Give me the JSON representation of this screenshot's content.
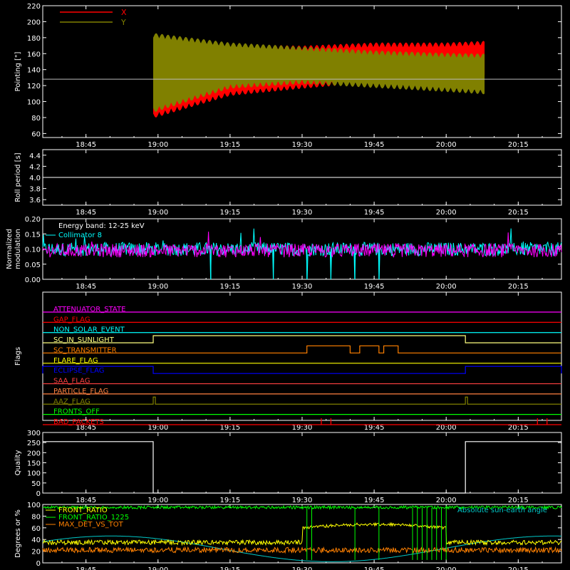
{
  "time_axis": {
    "start": "18:36",
    "end": "20:24",
    "ticks": [
      "18:45",
      "19:00",
      "19:15",
      "19:30",
      "19:45",
      "20:00",
      "20:15"
    ]
  },
  "chart_data": [
    {
      "type": "line",
      "ylabel": "Pointing [\"]",
      "ylim": [
        55,
        220
      ],
      "yticks": [
        "60",
        "80",
        "100",
        "120",
        "140",
        "160",
        "180",
        "200",
        "220"
      ],
      "legend_position": "top-left",
      "reference_line": 128,
      "start": "18:59",
      "end": "20:08",
      "series": [
        {
          "name": "X",
          "color": "#ff0000",
          "upper": [
            [
              "18:59",
              172
            ],
            [
              "19:15",
              166
            ],
            [
              "19:30",
              164
            ],
            [
              "19:45",
              168
            ],
            [
              "20:00",
              168
            ],
            [
              "20:08",
              170
            ]
          ],
          "lower": [
            [
              "18:59",
              85
            ],
            [
              "19:15",
              113
            ],
            [
              "19:30",
              122
            ],
            [
              "19:45",
              130
            ],
            [
              "20:00",
              135
            ],
            [
              "20:08",
              138
            ]
          ]
        },
        {
          "name": "Y",
          "color": "#808000",
          "upper": [
            [
              "18:59",
              180
            ],
            [
              "19:15",
              168
            ],
            [
              "19:30",
              163
            ],
            [
              "19:45",
              158
            ],
            [
              "20:00",
              155
            ],
            [
              "20:08",
              154
            ]
          ],
          "lower": [
            [
              "18:59",
              92
            ],
            [
              "19:15",
              122
            ],
            [
              "19:30",
              128
            ],
            [
              "19:45",
              123
            ],
            [
              "20:00",
              118
            ],
            [
              "20:08",
              115
            ]
          ]
        }
      ]
    },
    {
      "type": "line",
      "ylabel": "Roll period [s]",
      "ylim": [
        3.5,
        4.5
      ],
      "yticks": [
        "3.6",
        "3.8",
        "4.0",
        "4.2",
        "4.4"
      ],
      "series": [
        {
          "color": "#ffffff",
          "value": 4.0
        }
      ]
    },
    {
      "type": "line",
      "ylabel": "Normalized modulation",
      "ylim": [
        0,
        0.2
      ],
      "yticks": [
        "0.00",
        "0.05",
        "0.10",
        "0.15",
        "0.20"
      ],
      "legend_position": "top-left",
      "annotation": "Energy band: 12-25 keV",
      "series": [
        {
          "name": "Collimator 8",
          "color": "#00ffff",
          "mean": 0.1,
          "dropouts": [
            "19:11",
            "19:24",
            "19:31",
            "19:36",
            "19:41",
            "19:46"
          ]
        },
        {
          "color": "#ff00ff",
          "mean": 0.095
        }
      ]
    },
    {
      "type": "line",
      "ylabel": "Flags",
      "flags": [
        {
          "name": "ATTENUATOR_STATE",
          "color": "#ff00ff",
          "steps": []
        },
        {
          "name": "GAP_FLAG",
          "color": "#ff0000",
          "steps": []
        },
        {
          "name": "NON_SOLAR_EVENT",
          "color": "#00ffff",
          "steps": []
        },
        {
          "name": "SC_IN_SUNLIGHT",
          "color": "#ffff80",
          "steps": [
            [
              "18:59",
              "20:04"
            ]
          ]
        },
        {
          "name": "SC_TRANSMITTER",
          "color": "#ff8000",
          "steps": [
            [
              "19:31",
              "19:40"
            ],
            [
              "19:42",
              "19:46"
            ],
            [
              "19:47",
              "19:50"
            ]
          ]
        },
        {
          "name": "FLARE_FLAG",
          "color": "#ffff00",
          "steps": []
        },
        {
          "name": "ECLIPSE_FLAG",
          "color": "#0000ff",
          "steps": [
            [
              "18:36",
              "18:59"
            ],
            [
              "20:04",
              "20:24"
            ]
          ]
        },
        {
          "name": "SAA_FLAG",
          "color": "#ff4040",
          "steps": []
        },
        {
          "name": "PARTICLE_FLAG",
          "color": "#ff8040",
          "steps": []
        },
        {
          "name": "AAZ_FLAG",
          "color": "#808000",
          "steps": [
            [
              "18:59",
              "18:59"
            ],
            [
              "20:04",
              "20:04"
            ]
          ]
        },
        {
          "name": "FRONTS_OFF",
          "color": "#00ff00",
          "steps": []
        },
        {
          "name": "BAD_PACKETS",
          "color": "#ff0000",
          "spikes": [
            "19:34",
            "19:36",
            "20:19",
            "20:21"
          ]
        }
      ]
    },
    {
      "type": "line",
      "ylabel": "Quality",
      "ylim": [
        0,
        300
      ],
      "yticks": [
        "0",
        "50",
        "100",
        "150",
        "200",
        "250",
        "300"
      ],
      "series": [
        {
          "color": "#ffffff",
          "points": [
            [
              "18:36",
              255
            ],
            [
              "18:59",
              255
            ],
            [
              "18:59",
              0
            ],
            [
              "20:04",
              0
            ],
            [
              "20:04",
              255
            ],
            [
              "20:24",
              255
            ]
          ]
        }
      ]
    },
    {
      "type": "line",
      "ylabel": "Degrees or %",
      "ylim": [
        0,
        100
      ],
      "yticks": [
        "0",
        "20",
        "40",
        "60",
        "80",
        "100"
      ],
      "legend_position": "top-left",
      "right_legend": "Absolute sun-earth angle",
      "series": [
        {
          "name": "FRONT_RATIO",
          "color": "#ffff00",
          "mean": 35
        },
        {
          "name": "FRONT_RATIO_1225",
          "color": "#00ff00",
          "mean": 95
        },
        {
          "name": "MAX_DET_VS_TOT",
          "color": "#ff8000",
          "mean": 22
        },
        {
          "name": "Absolute sun-earth angle",
          "color": "#00c8c8"
        }
      ]
    }
  ]
}
